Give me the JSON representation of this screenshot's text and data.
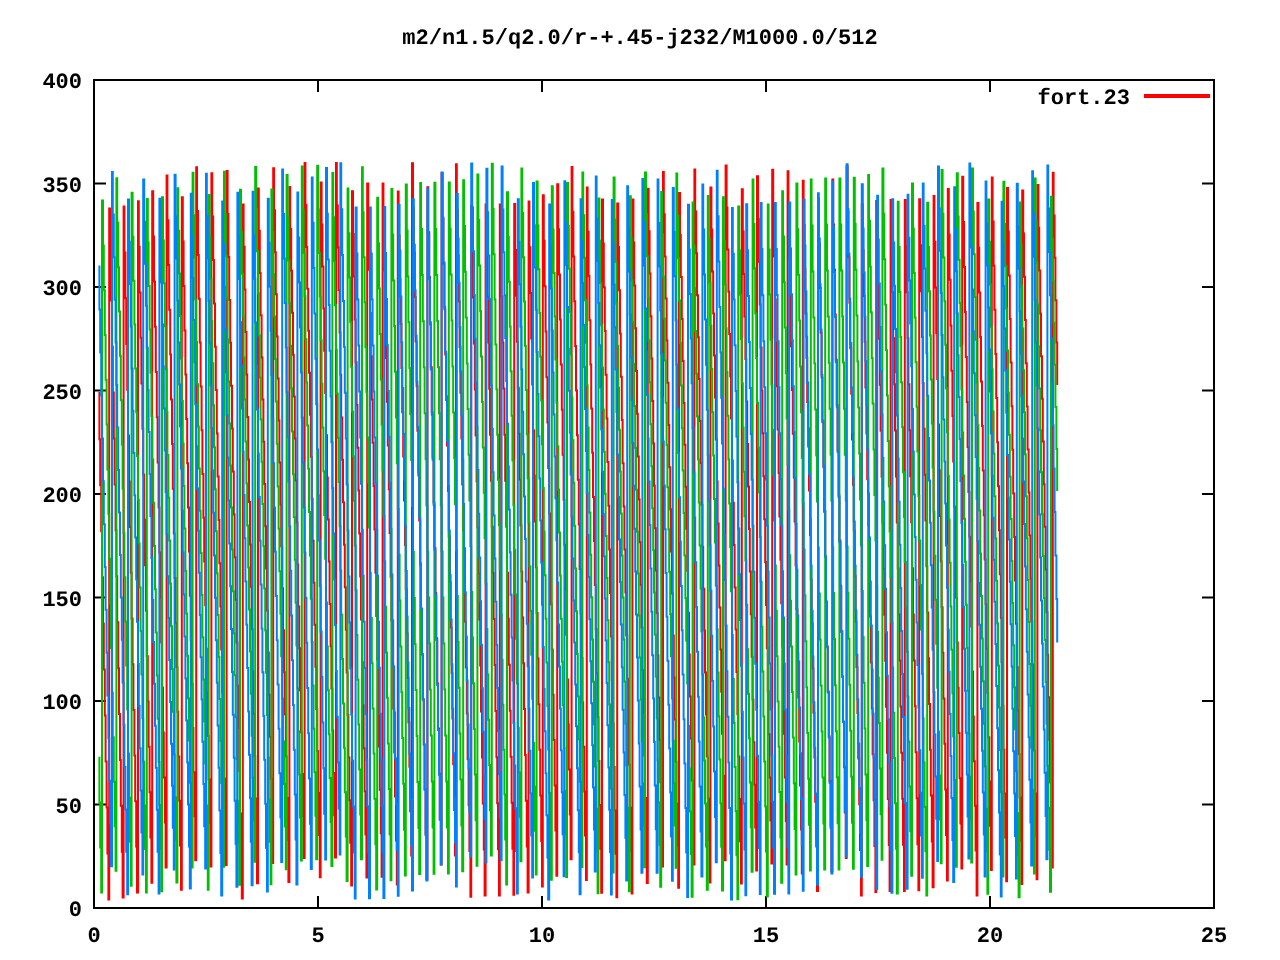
{
  "plot": {
    "title": "m2/n1.5/q2.0/r-+.45-j232/M1000.0/512",
    "y_tick_labels": [
      "400",
      "350",
      "300",
      "250",
      "200",
      "150",
      "100",
      "50",
      "0"
    ],
    "x_tick_labels": [
      "0",
      "5",
      "10",
      "15",
      "20",
      "25"
    ],
    "legend": {
      "label": "fort.23",
      "color": "#ff0000"
    }
  }
}
